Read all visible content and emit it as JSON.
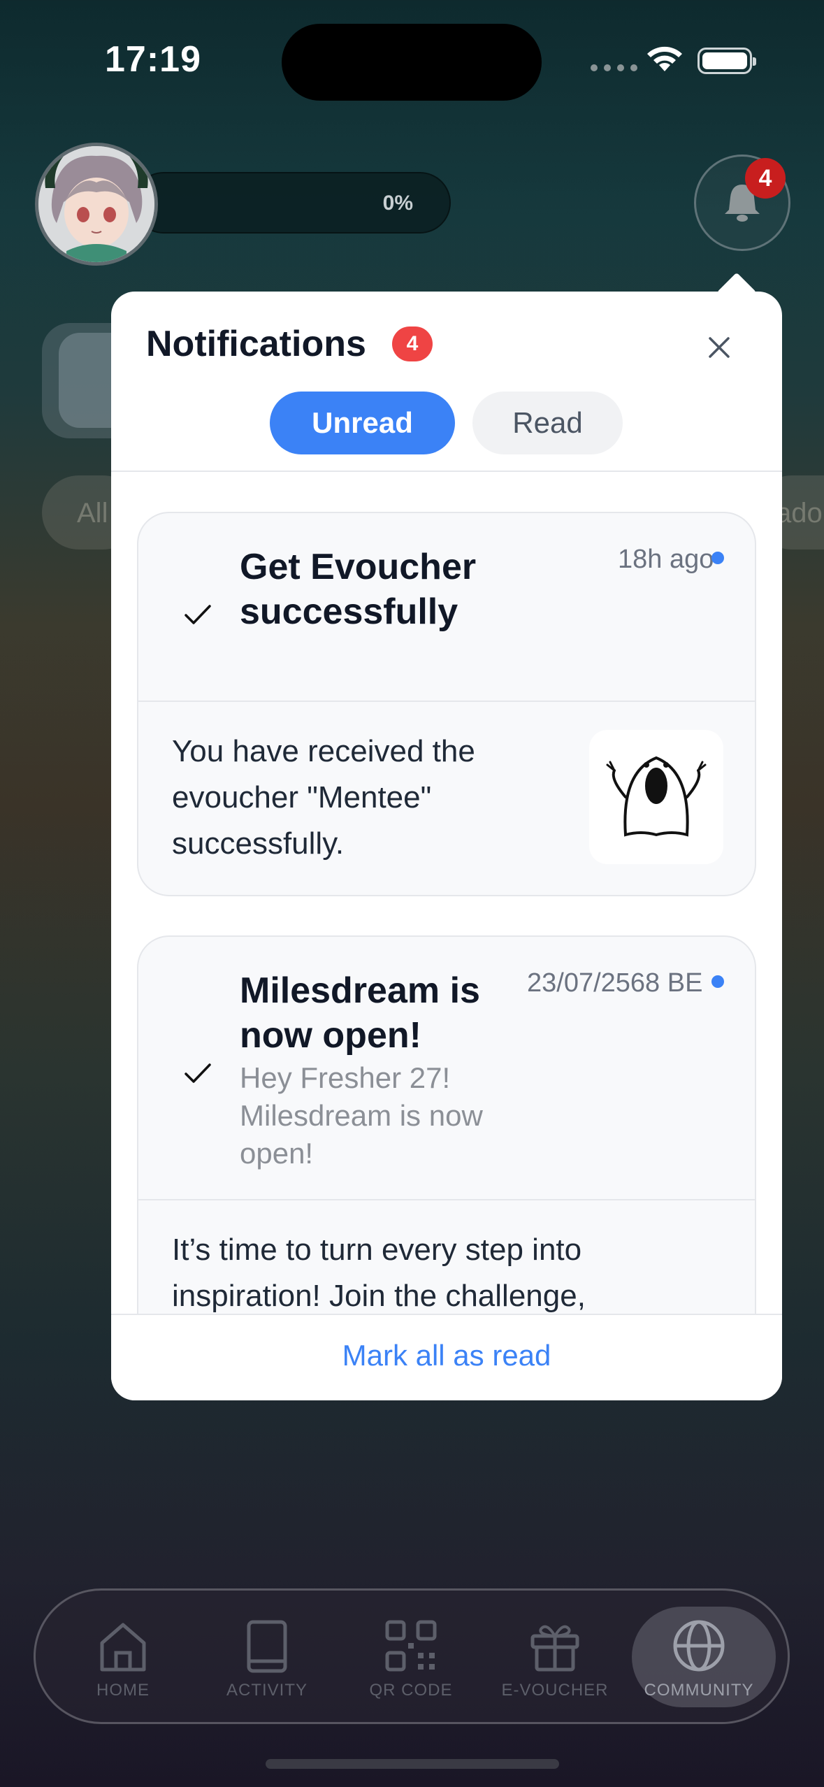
{
  "status_bar": {
    "time": "17:19"
  },
  "profile": {
    "progress_text": "0%"
  },
  "bell": {
    "badge_count": "4"
  },
  "background_chips": {
    "all_label": "All",
    "right_label": "ado"
  },
  "notifications_modal": {
    "title": "Notifications",
    "badge_count": "4",
    "tabs": [
      {
        "label": "Unread",
        "active": true
      },
      {
        "label": "Read",
        "active": false
      }
    ],
    "items": [
      {
        "title": "Get Evoucher successfully",
        "time": "18h ago",
        "subtitle": "",
        "body": "You have received the evoucher \"Mentee\" successfully.",
        "unread": true
      },
      {
        "title": "Milesdream is now open!",
        "time": "23/07/2568 BE",
        "subtitle": "Hey Fresher 27! Milesdream is now open!",
        "body": "It’s time to turn every step into inspiration!  Join the challenge,",
        "unread": true
      }
    ],
    "footer_action": "Mark all as read"
  },
  "tab_bar": {
    "items": [
      {
        "label": "HOME",
        "icon": "home-icon"
      },
      {
        "label": "ACTIVITY",
        "icon": "book-icon"
      },
      {
        "label": "QR CODE",
        "icon": "qr-code-icon"
      },
      {
        "label": "E-VOUCHER",
        "icon": "gift-icon"
      },
      {
        "label": "COMMUNITY",
        "icon": "globe-icon",
        "active": true
      }
    ]
  },
  "colors": {
    "accent": "#3b82f6",
    "badge_red": "#ef4444"
  }
}
